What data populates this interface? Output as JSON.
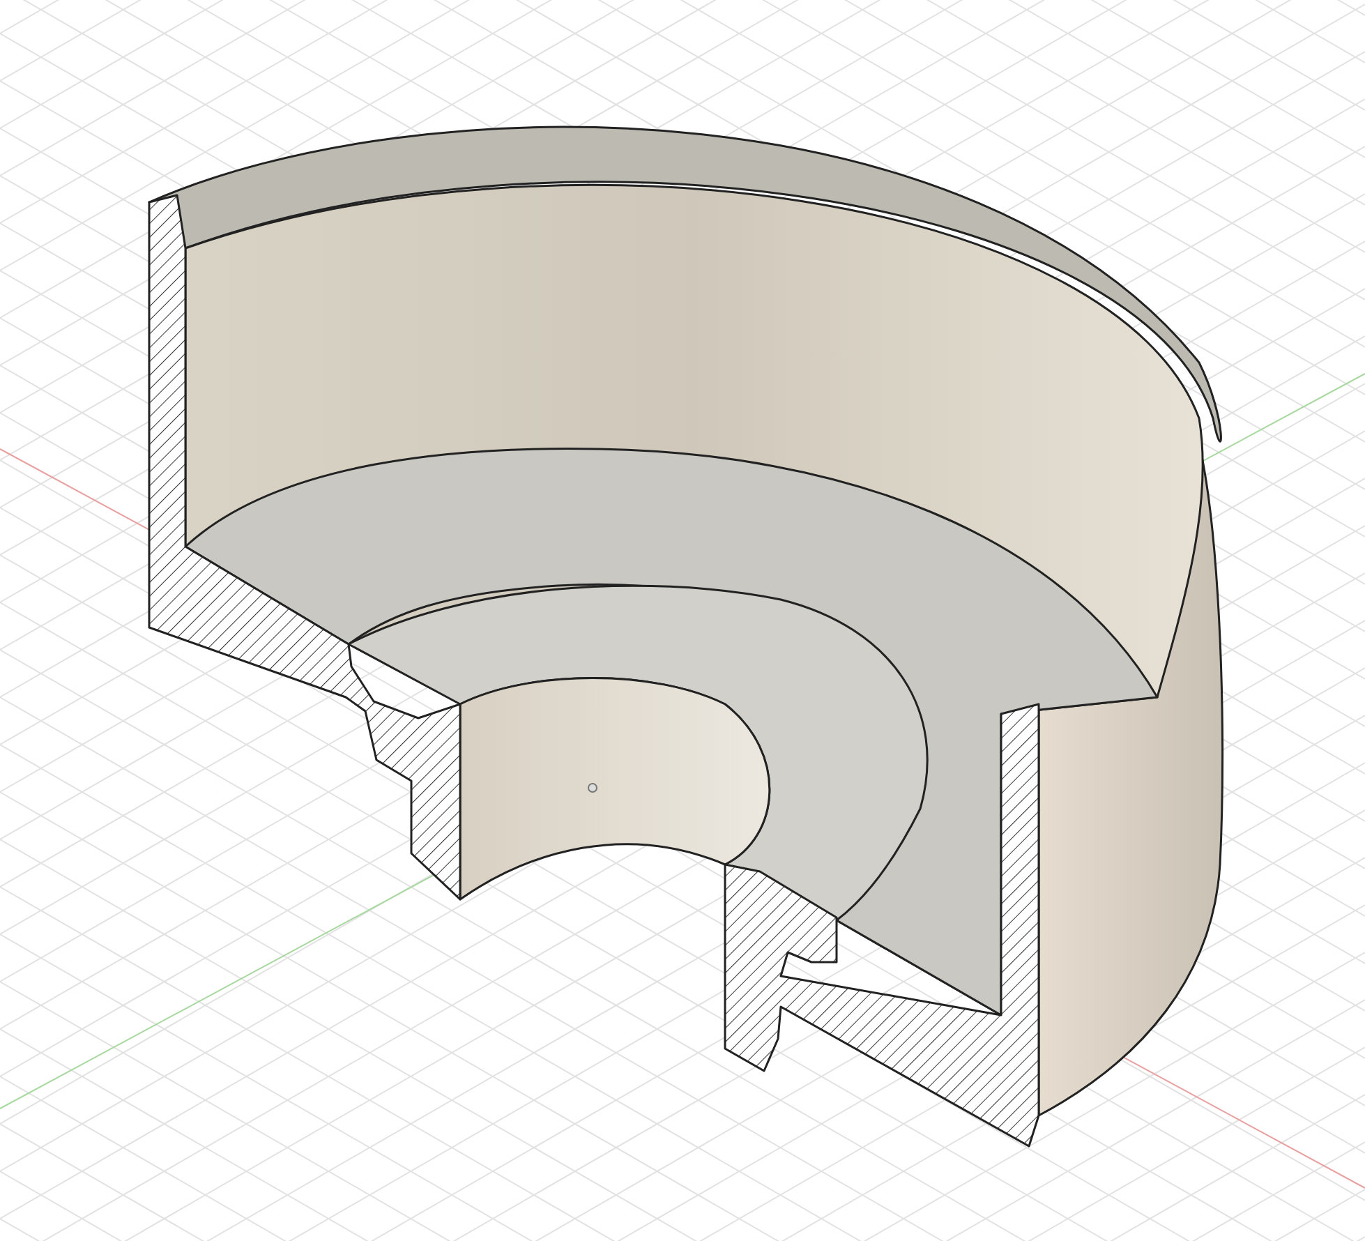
{
  "viewport": {
    "kind": "section-view",
    "show_grid": true,
    "show_axes": true
  }
}
